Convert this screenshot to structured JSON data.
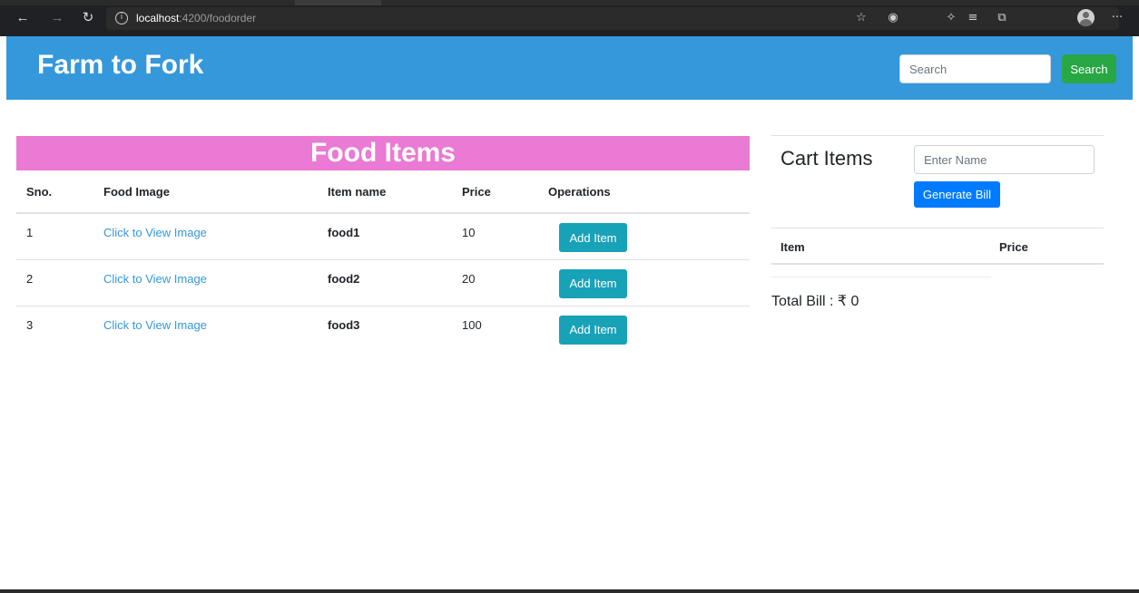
{
  "browser": {
    "url_host": "localhost",
    "url_path": ":4200/foodorder"
  },
  "header": {
    "brand": "Farm to Fork",
    "search_placeholder": "Search",
    "search_button": "Search",
    "color": "#3498db"
  },
  "food": {
    "banner": "Food Items",
    "banner_color": "#ea7ad3",
    "columns": [
      "Sno.",
      "Food Image",
      "Item name",
      "Price",
      "Operations"
    ],
    "rows": [
      {
        "sno": "1",
        "image_link": "Click to View Image",
        "name": "food1",
        "price": "10",
        "action": "Add Item"
      },
      {
        "sno": "2",
        "image_link": "Click to View Image",
        "name": "food2",
        "price": "20",
        "action": "Add Item"
      },
      {
        "sno": "3",
        "image_link": "Click to View Image",
        "name": "food3",
        "price": "100",
        "action": "Add Item"
      }
    ]
  },
  "cart": {
    "title": "Cart Items",
    "name_placeholder": "Enter Name",
    "generate_button": "Generate Bill",
    "col_item": "Item",
    "col_price": "Price",
    "total": "Total Bill : ₹ 0"
  }
}
